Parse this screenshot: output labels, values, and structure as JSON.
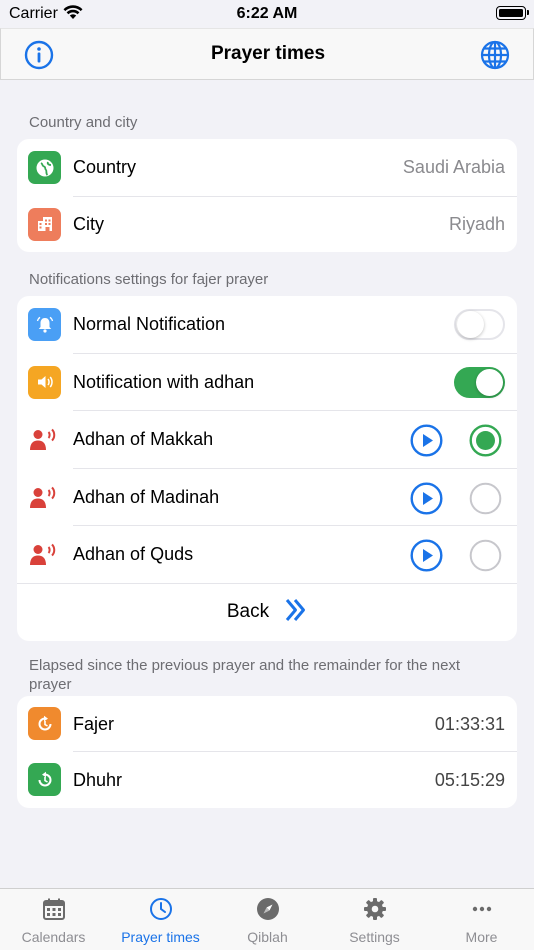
{
  "status_bar": {
    "carrier": "Carrier",
    "time": "6:22 AM"
  },
  "nav": {
    "title": "Prayer times",
    "left_icon": "info-icon",
    "right_icon": "globe-icon"
  },
  "location": {
    "header": "Country and city",
    "country_label": "Country",
    "country_value": "Saudi Arabia",
    "city_label": "City",
    "city_value": "Riyadh"
  },
  "notifications": {
    "header": "Notifications settings for fajer prayer",
    "normal_label": "Normal Notification",
    "normal_on": false,
    "adhan_label": "Notification with adhan",
    "adhan_on": true,
    "adhans": [
      {
        "label": "Adhan of Makkah",
        "selected": true
      },
      {
        "label": "Adhan of Madinah",
        "selected": false
      },
      {
        "label": "Adhan of Quds",
        "selected": false
      }
    ],
    "back_label": "Back"
  },
  "elapsed": {
    "header": "Elapsed since the previous prayer and the remainder for the next prayer",
    "rows": [
      {
        "label": "Fajer",
        "value": "01:33:31"
      },
      {
        "label": "Dhuhr",
        "value": "05:15:29"
      }
    ]
  },
  "tabs": [
    {
      "label": "Calendars",
      "icon": "calendar-icon",
      "active": false
    },
    {
      "label": "Prayer times",
      "icon": "clock-icon",
      "active": true
    },
    {
      "label": "Qiblah",
      "icon": "compass-icon",
      "active": false
    },
    {
      "label": "Settings",
      "icon": "gear-icon",
      "active": false
    },
    {
      "label": "More",
      "icon": "more-icon",
      "active": false
    }
  ],
  "colors": {
    "accent": "#1a73e8",
    "green": "#34a853",
    "country_icon": "#34a853",
    "city_icon": "#ee7d5c",
    "bell_icon": "#4a9ff5",
    "sound_icon": "#f5a623",
    "speaker_icon": "#d9413a",
    "fajer_icon": "#f08a2e",
    "dhuhr_icon": "#34a853"
  }
}
